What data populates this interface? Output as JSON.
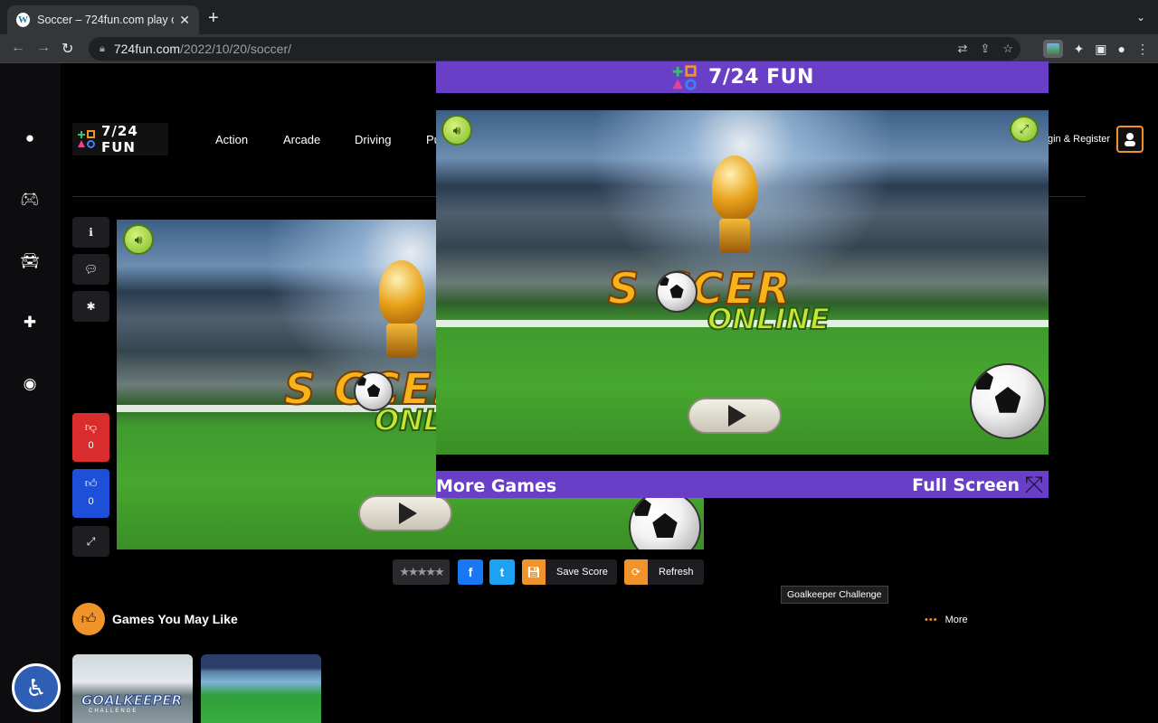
{
  "browser": {
    "tab_title": "Soccer – 724fun.com play onli",
    "tab_close": "✕",
    "new_tab": "+",
    "url_host": "724fun.com",
    "url_path": "/2022/10/20/soccer/"
  },
  "site": {
    "logo_text": "7/24 FUN",
    "nav": [
      "Action",
      "Arcade",
      "Driving",
      "Pu"
    ],
    "login_label": "gin & Register"
  },
  "votes": {
    "dislike_count": "0",
    "like_count": "0"
  },
  "game": {
    "logo_line1": "S  CCER",
    "logo_line2": "ONLINE"
  },
  "actions": {
    "facebook_glyph": "f",
    "twitter_glyph": "t",
    "save_score": "Save Score",
    "refresh": "Refresh"
  },
  "tooltip": "Goalkeeper Challenge",
  "section": {
    "title": "Games You May Like",
    "more": "More"
  },
  "thumbs": [
    {
      "label": "GOALKEEPER",
      "sub": "CHALLENGE"
    },
    {
      "label": "",
      "sub": ""
    }
  ],
  "popup": {
    "title": "7/24 FUN",
    "more_games": "More Games",
    "full_screen": "Full Screen"
  },
  "colors": {
    "accent_orange": "#f0932b",
    "popup_purple": "#6a3fc8",
    "dislike_red": "#d92d2d",
    "like_blue": "#1d4fd8"
  }
}
